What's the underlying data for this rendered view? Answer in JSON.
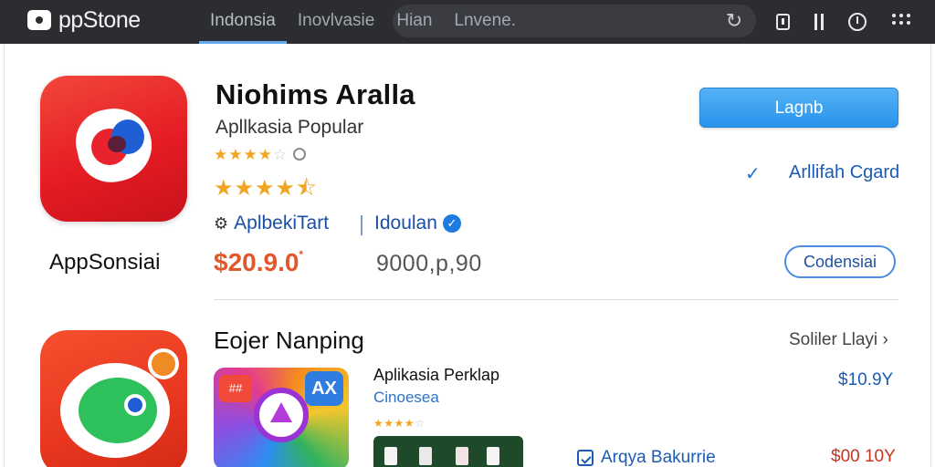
{
  "header": {
    "logo_text": "ppStone",
    "tabs": [
      {
        "label": "Indonsia"
      },
      {
        "label": "Inovlvasie"
      },
      {
        "label": "Hian"
      },
      {
        "label": "Lnvene."
      }
    ],
    "active_tab_index": 0,
    "icons": [
      "refresh-icon",
      "window-icon",
      "columns-icon",
      "clock-icon",
      "grid-menu-icon"
    ]
  },
  "featured_app": {
    "icon_caption": "AppSonsiai",
    "title": "Niohims Aralla",
    "subtitle": "Apllkasia Popular",
    "rating_small": {
      "filled": 4,
      "total": 5
    },
    "rating_large": {
      "filled": 4.5,
      "total": 5
    },
    "developer": "AplbekiTart",
    "language": "Idoulan",
    "price": "$20.9.0",
    "price_mark": "*",
    "secondary_price": "9000,p,90",
    "get_button": "Lagnb",
    "link_label": "Arllifah Cgard",
    "outline_button": "Codensiai"
  },
  "section": {
    "title": "Eojer Nanping",
    "see_all": "Soliler Llayi",
    "app": {
      "tile_badge_left": "##",
      "tile_badge_right": "AX",
      "title": "Aplikasia Perklap",
      "category": "Cinoesea",
      "rating": {
        "filled": 4,
        "total": 5
      },
      "price": "$10.9Y",
      "store_label": "Arqya  Bakurrie",
      "price_secondary": "$00 10Y"
    }
  },
  "colors": {
    "topbar": "#2b2d31",
    "accent_blue": "#2893ec",
    "price_orange": "#e2572a",
    "star": "#f0a623"
  }
}
